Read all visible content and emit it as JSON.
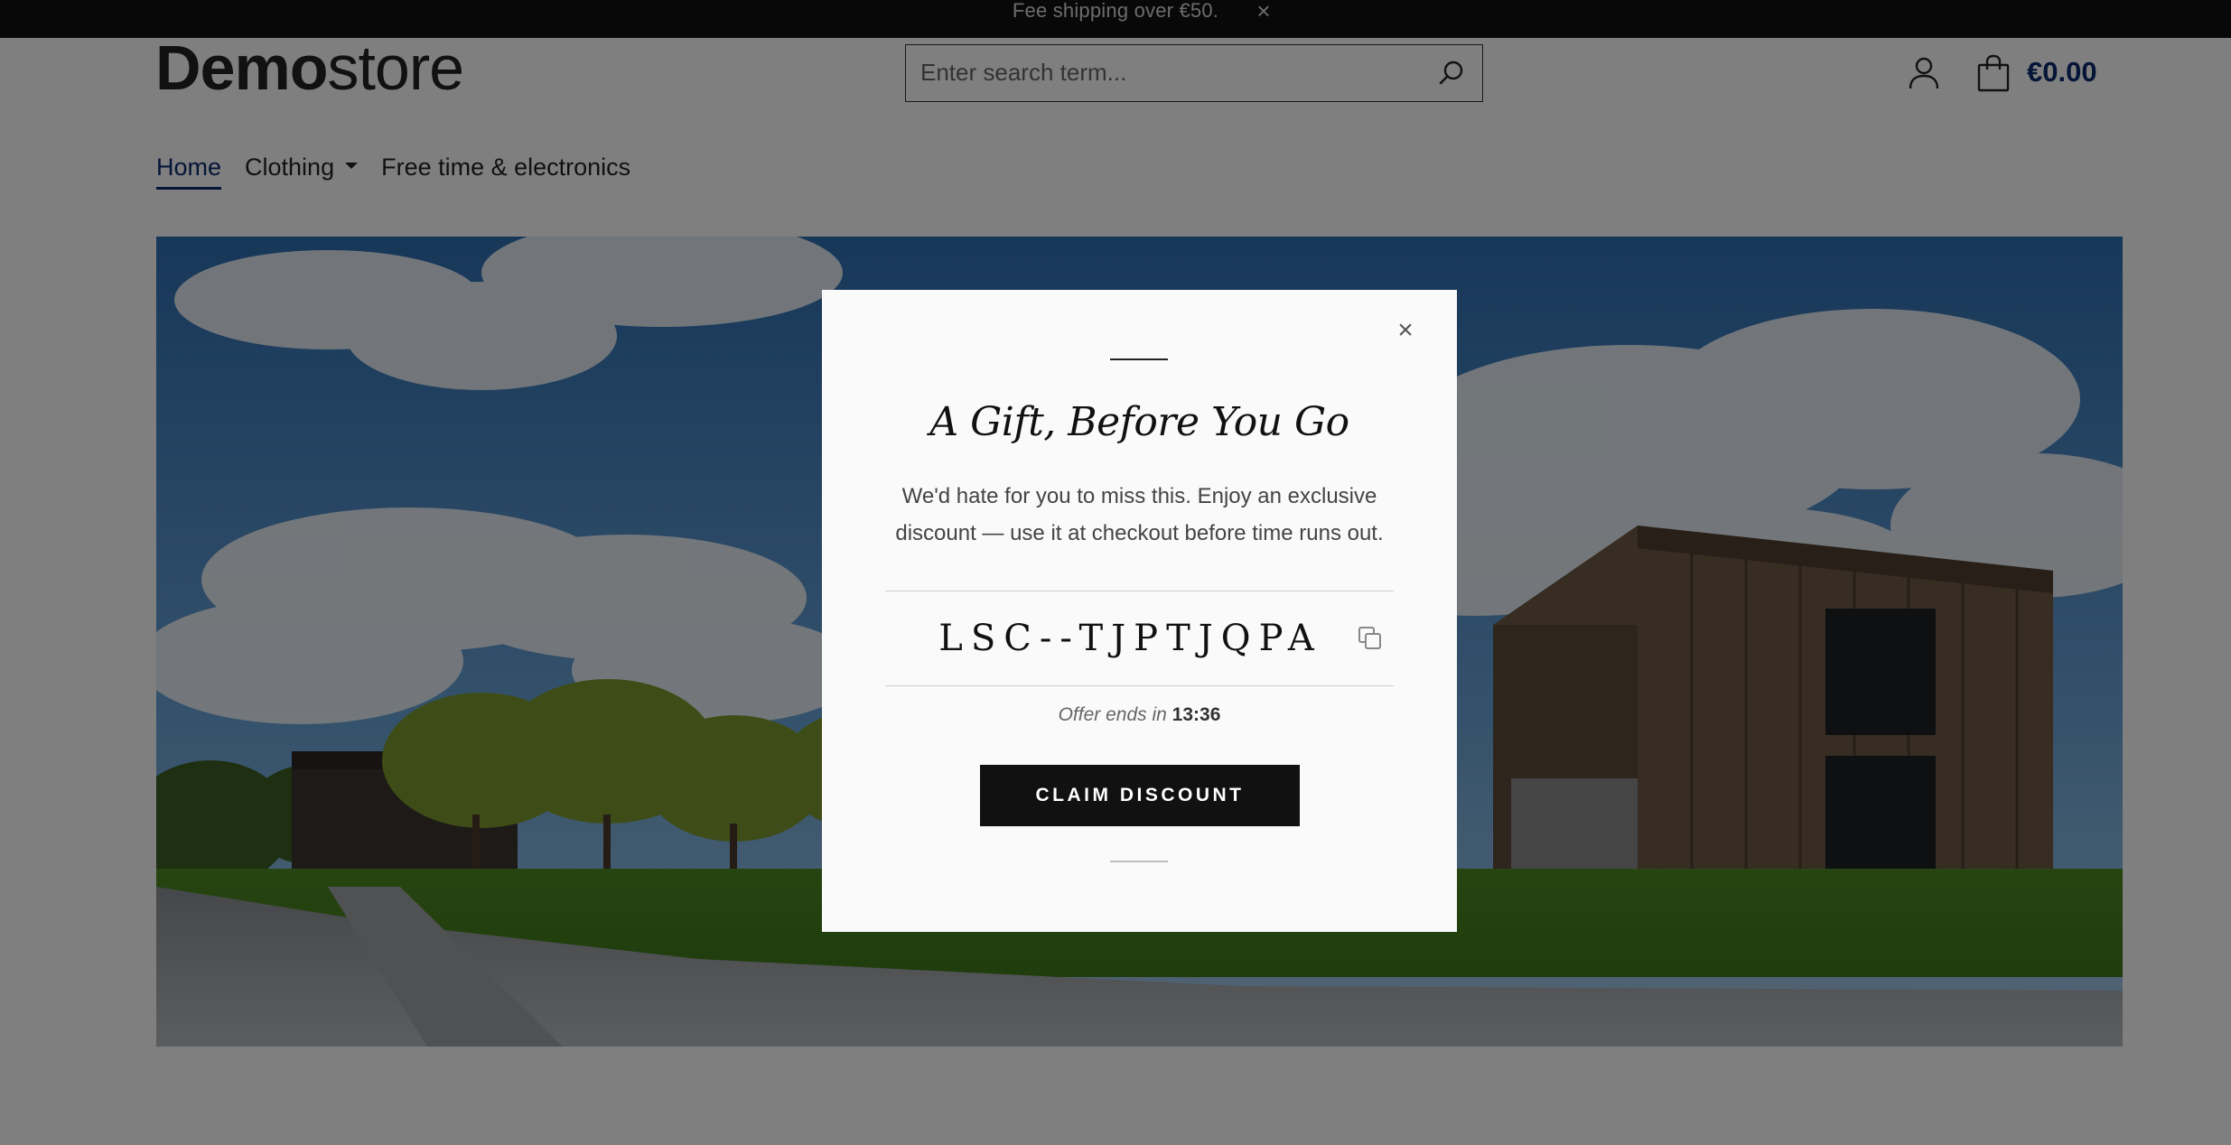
{
  "topbar": {
    "message": "Fee shipping over €50.",
    "close_label": "×"
  },
  "header": {
    "logo_bold": "Demo",
    "logo_light": "store",
    "search_placeholder": "Enter search term...",
    "search_value": "",
    "cart_total": "€0.00"
  },
  "nav": {
    "items": [
      {
        "label": "Home",
        "active": true
      },
      {
        "label": "Clothing",
        "has_dropdown": true
      },
      {
        "label": "Free time & electronics"
      }
    ]
  },
  "modal": {
    "close_label": "×",
    "title": "A Gift, Before You Go",
    "description": "We'd hate for you to miss this. Enjoy an exclusive discount — use it at checkout before time runs out.",
    "code": "LSC--TJPTJQPA",
    "offer_prefix": "Offer ends in",
    "offer_time": "13:36",
    "cta_label": "CLAIM DISCOUNT"
  },
  "colors": {
    "accent": "#0b2a6e",
    "topbar_bg": "#111111",
    "button_bg": "#111111",
    "overlay": "rgba(0,0,0,0.5)"
  },
  "icons": {
    "search": "search-icon",
    "account": "account-icon",
    "cart": "cart-icon",
    "copy": "copy-icon",
    "close": "close-icon"
  }
}
